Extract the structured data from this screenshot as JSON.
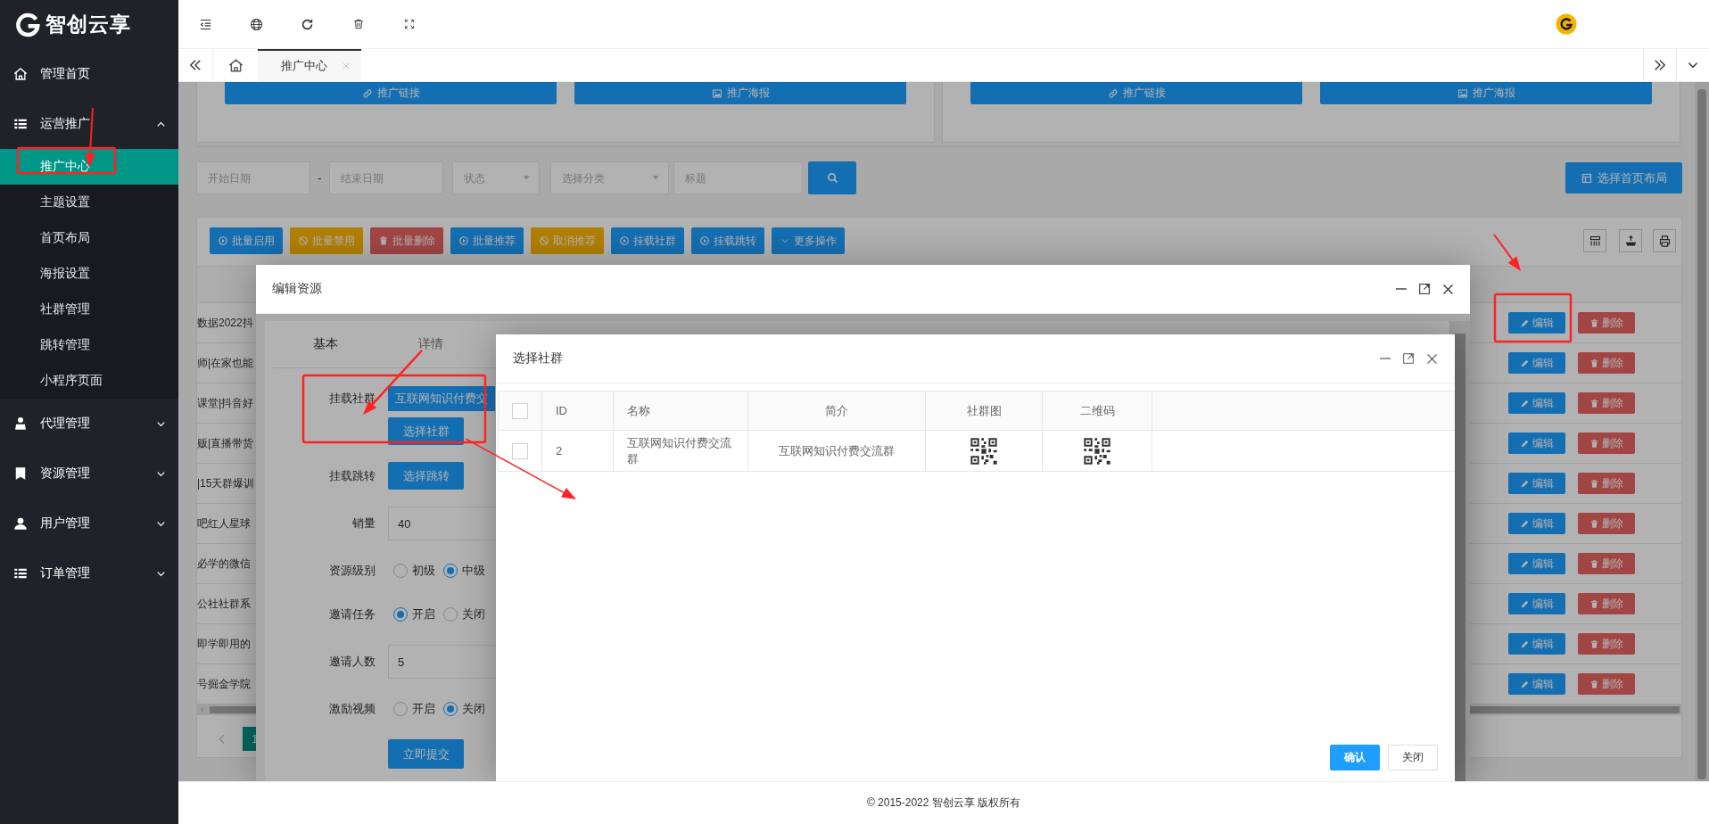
{
  "sidebar": {
    "logo": "智创云享",
    "menu": [
      {
        "label": "管理首页"
      },
      {
        "label": "运营推广",
        "expanded": true,
        "children": [
          {
            "label": "推广中心",
            "selected": true
          },
          {
            "label": "主题设置",
            "selected": false
          },
          {
            "label": "首页布局",
            "selected": false
          },
          {
            "label": "海报设置",
            "selected": false
          },
          {
            "label": "社群管理",
            "selected": false
          },
          {
            "label": "跳转管理",
            "selected": false
          },
          {
            "label": "小程序页面",
            "selected": false
          }
        ]
      },
      {
        "label": "代理管理",
        "expanded": false
      },
      {
        "label": "资源管理",
        "expanded": false
      },
      {
        "label": "用户管理",
        "expanded": false
      },
      {
        "label": "订单管理",
        "expanded": false
      }
    ]
  },
  "tabs": [
    {
      "label": "推广中心",
      "selected": true
    }
  ],
  "page": {
    "promo_cards": [
      {
        "buttons": [
          "推广链接",
          "推广海报"
        ]
      },
      {
        "buttons": [
          "推广链接",
          "推广海报"
        ]
      }
    ],
    "filters": {
      "start_date": {
        "placeholder": "开始日期"
      },
      "separator": "-",
      "end_date": {
        "placeholder": "结束日期"
      },
      "status": {
        "placeholder": "状态"
      },
      "category": {
        "placeholder": "选择分类"
      },
      "title": {
        "placeholder": "标题"
      }
    },
    "layout_button": "选择首页布局",
    "toolbar": [
      {
        "label": "批量启用",
        "kind": "normal"
      },
      {
        "label": "批量禁用",
        "kind": "warm"
      },
      {
        "label": "批量删除",
        "kind": "danger"
      },
      {
        "label": "批量推荐",
        "kind": "normal"
      },
      {
        "label": "取消推荐",
        "kind": "warm"
      },
      {
        "label": "挂载社群",
        "kind": "normal"
      },
      {
        "label": "挂载跳转",
        "kind": "normal"
      },
      {
        "label": "更多操作",
        "kind": "normal"
      }
    ],
    "rows": [
      {
        "title": "数据2022抖",
        "actions": [
          "编辑",
          "删除"
        ]
      },
      {
        "title": "师|在家也能",
        "actions": [
          "编辑",
          "删除"
        ]
      },
      {
        "title": "课堂|抖音好",
        "actions": [
          "编辑",
          "删除"
        ]
      },
      {
        "title": "贩|直播带货",
        "actions": [
          "编辑",
          "删除"
        ]
      },
      {
        "title": "|15天群爆训",
        "actions": [
          "编辑",
          "删除"
        ]
      },
      {
        "title": "吧红人星球",
        "actions": [
          "编辑",
          "删除"
        ]
      },
      {
        "title": "必学的微信",
        "actions": [
          "编辑",
          "删除"
        ]
      },
      {
        "title": "公社社群系",
        "actions": [
          "编辑",
          "删除"
        ]
      },
      {
        "title": "即学即用的",
        "actions": [
          "编辑",
          "删除"
        ]
      },
      {
        "title": "号掘金学院",
        "actions": [
          "编辑",
          "删除"
        ]
      }
    ],
    "pagination": [
      {
        "label": "1",
        "selected": true
      }
    ]
  },
  "edit_dialog": {
    "title": "编辑资源",
    "tabs": [
      {
        "label": "基本",
        "selected": true
      },
      {
        "label": "详情",
        "selected": false
      }
    ],
    "fields": [
      {
        "kind": "chips",
        "label": "挂载社群",
        "chip": "互联网知识付费交",
        "button": "选择社群"
      },
      {
        "kind": "button",
        "label": "挂载跳转",
        "button": "选择跳转"
      },
      {
        "kind": "input",
        "label": "销量",
        "value": "40"
      },
      {
        "kind": "radio",
        "label": "资源级别",
        "options": [
          {
            "label": "初级",
            "selected": false
          },
          {
            "label": "中级",
            "selected": true
          }
        ]
      },
      {
        "kind": "radio",
        "label": "邀请任务",
        "options": [
          {
            "label": "开启",
            "selected": true
          },
          {
            "label": "关闭",
            "selected": false
          }
        ]
      },
      {
        "kind": "input",
        "label": "邀请人数",
        "value": "5"
      },
      {
        "kind": "radio",
        "label": "激励视频",
        "options": [
          {
            "label": "开启",
            "selected": false
          },
          {
            "label": "关闭",
            "selected": true
          }
        ]
      }
    ],
    "submit": "立即提交"
  },
  "select_dialog": {
    "title": "选择社群",
    "all_checked": false,
    "columns": [
      "ID",
      "名称",
      "简介",
      "社群图",
      "二维码"
    ],
    "rows": [
      {
        "checked": false,
        "cells": [
          "2",
          "互联网知识付费交流群",
          "互联网知识付费交流群"
        ]
      }
    ],
    "buttons": [
      {
        "label": "确认",
        "kind": "primary"
      },
      {
        "label": "关闭",
        "kind": "default"
      }
    ]
  },
  "footer": "© 2015-2022 智创云享 版权所有"
}
